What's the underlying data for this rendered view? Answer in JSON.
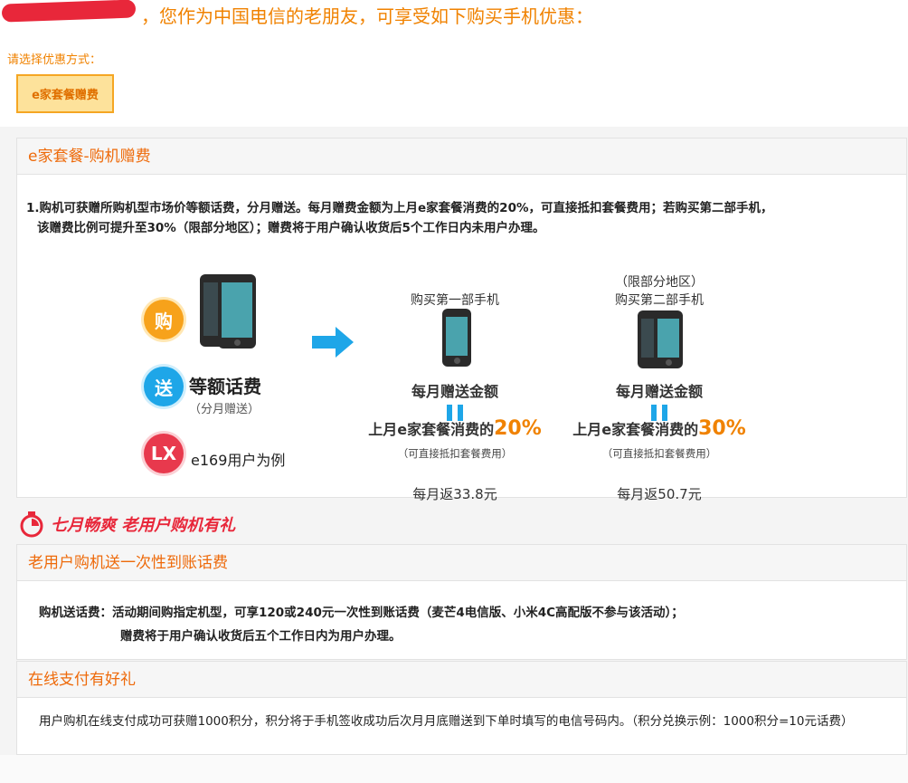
{
  "header": {
    "greeting": "，您作为中国电信的老朋友，可享受如下购买手机优惠：",
    "choose_label": "请选择优惠方式：",
    "method_button": "e家套餐赠费"
  },
  "panel1": {
    "title": "e家套餐-购机赠费",
    "desc_line1": "1.购机可获赠所购机型市场价等额话费，分月赠送。每月赠费金额为上月e家套餐消费的20%，可直接抵扣套餐费用；若购买第二部手机，",
    "desc_line2": "该赠费比例可提升至30%（限部分地区）；赠费将于用户确认收货后5个工作日内未用户办理。",
    "icon_buy": "购",
    "icon_give": "送",
    "icon_lx": "LX",
    "equal_main": "等额话费",
    "equal_sub": "（分月赠送）",
    "example": "e169用户为例",
    "col_a": {
      "title": "购买第一部手机",
      "amount_label": "每月赠送金额",
      "pct_prefix": "上月e家套餐消费的",
      "pct": "20%",
      "offset_note": "（可直接抵扣套餐费用）",
      "monthly": "每月返33.8元"
    },
    "col_b": {
      "region": "（限部分地区）",
      "title": "购买第二部手机",
      "amount_label": "每月赠送金额",
      "pct_prefix": "上月e家套餐消费的",
      "pct": "30%",
      "offset_note": "（可直接抵扣套餐费用）",
      "monthly": "每月返50.7元"
    }
  },
  "promo": {
    "text": "七月畅爽 老用户购机有礼"
  },
  "panel2": {
    "title": "老用户购机送一次性到账话费",
    "line1": "购机送话费：活动期间购指定机型，可享120或240元一次性到账话费（麦芒4电信版、小米4C高配版不参与该活动）；",
    "line2": "赠费将于用户确认收货后五个工作日内为用户办理。"
  },
  "panel3": {
    "title": "在线支付有好礼",
    "desc": "用户购机在线支付成功可获赠1000积分，积分将于手机签收成功后次月月底赠送到下单时填写的电信号码内。（积分兑换示例：1000积分=10元话费）"
  },
  "colors": {
    "accent": "#f08200",
    "blue": "#1ea6e8",
    "red": "#e8273a"
  }
}
